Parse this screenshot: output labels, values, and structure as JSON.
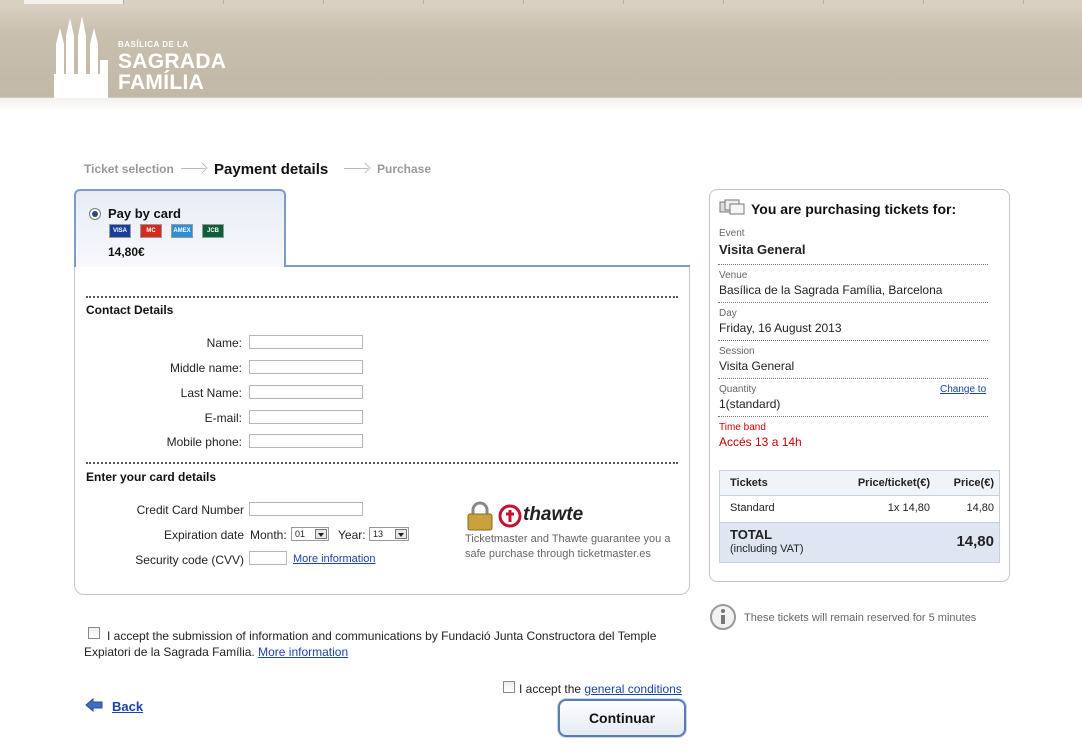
{
  "logo": {
    "line1": "BASÍLICA DE LA",
    "line2": "SAGRADA",
    "line3": "FAMÍLIA"
  },
  "breadcrumb": {
    "step1": "Ticket selection",
    "step2": "Payment details",
    "step3": "Purchase"
  },
  "payment": {
    "method_label": "Pay by card",
    "amount": "14,80€",
    "cards": [
      "visa-icon",
      "mastercard-icon",
      "amex-icon",
      "jcb-icon"
    ],
    "cards_text": [
      "VISA",
      "MC",
      "AMEX",
      "JCB"
    ]
  },
  "contact": {
    "title": "Contact Details",
    "name_label": "Name:",
    "middle_label": "Middle name:",
    "last_label": "Last Name:",
    "email_label": "E-mail:",
    "mobile_label": "Mobile phone:"
  },
  "card_details": {
    "title": "Enter your card details",
    "number_label": "Credit Card Number",
    "expiration_label": "Expiration date",
    "month_label": "Month:",
    "month_value": "01",
    "year_label": "Year:",
    "year_value": "13",
    "cvv_label": "Security code (CVV)",
    "cvv_link": "More information"
  },
  "thawte": {
    "brand": "thawte",
    "text": "Ticketmaster and Thawte guarantee you a safe purchase through ticketmaster.es"
  },
  "consent": {
    "text": "I accept the submission of information and communications by Fundació Junta Constructora del Temple Expiatori de la Sagrada Família.",
    "link": "More information"
  },
  "conditions": {
    "text": "I accept the",
    "link": "general conditions"
  },
  "buttons": {
    "back": "Back",
    "continue": "Continuar"
  },
  "summary": {
    "heading": "You are purchasing tickets for:",
    "event_label": "Event",
    "event_value": "Visita General",
    "venue_label": "Venue",
    "venue_value": "Basílica de la Sagrada Família, Barcelona",
    "day_label": "Day",
    "day_value": "Friday, 16 August 2013",
    "session_label": "Session",
    "session_value": "Visita General",
    "quantity_label": "Quantity",
    "quantity_value": "1(standard)",
    "change_link": "Change to",
    "timeband_label": "Time band",
    "timeband_value": "Accés 13 a 14h",
    "table": {
      "col_tickets": "Tickets",
      "col_price_ticket": "Price/ticket(€)",
      "col_price": "Price(€)",
      "row_type": "Standard",
      "row_qty_price": "1x 14,80",
      "row_price": "14,80",
      "total_label": "TOTAL",
      "total_sub": "(including VAT)",
      "total_value": "14,80"
    }
  },
  "reservation_note": "These tickets will remain reserved for 5 minutes",
  "colors": {
    "accent": "#7e9bc4",
    "red": "#cc0000",
    "link": "#1a44a8"
  }
}
